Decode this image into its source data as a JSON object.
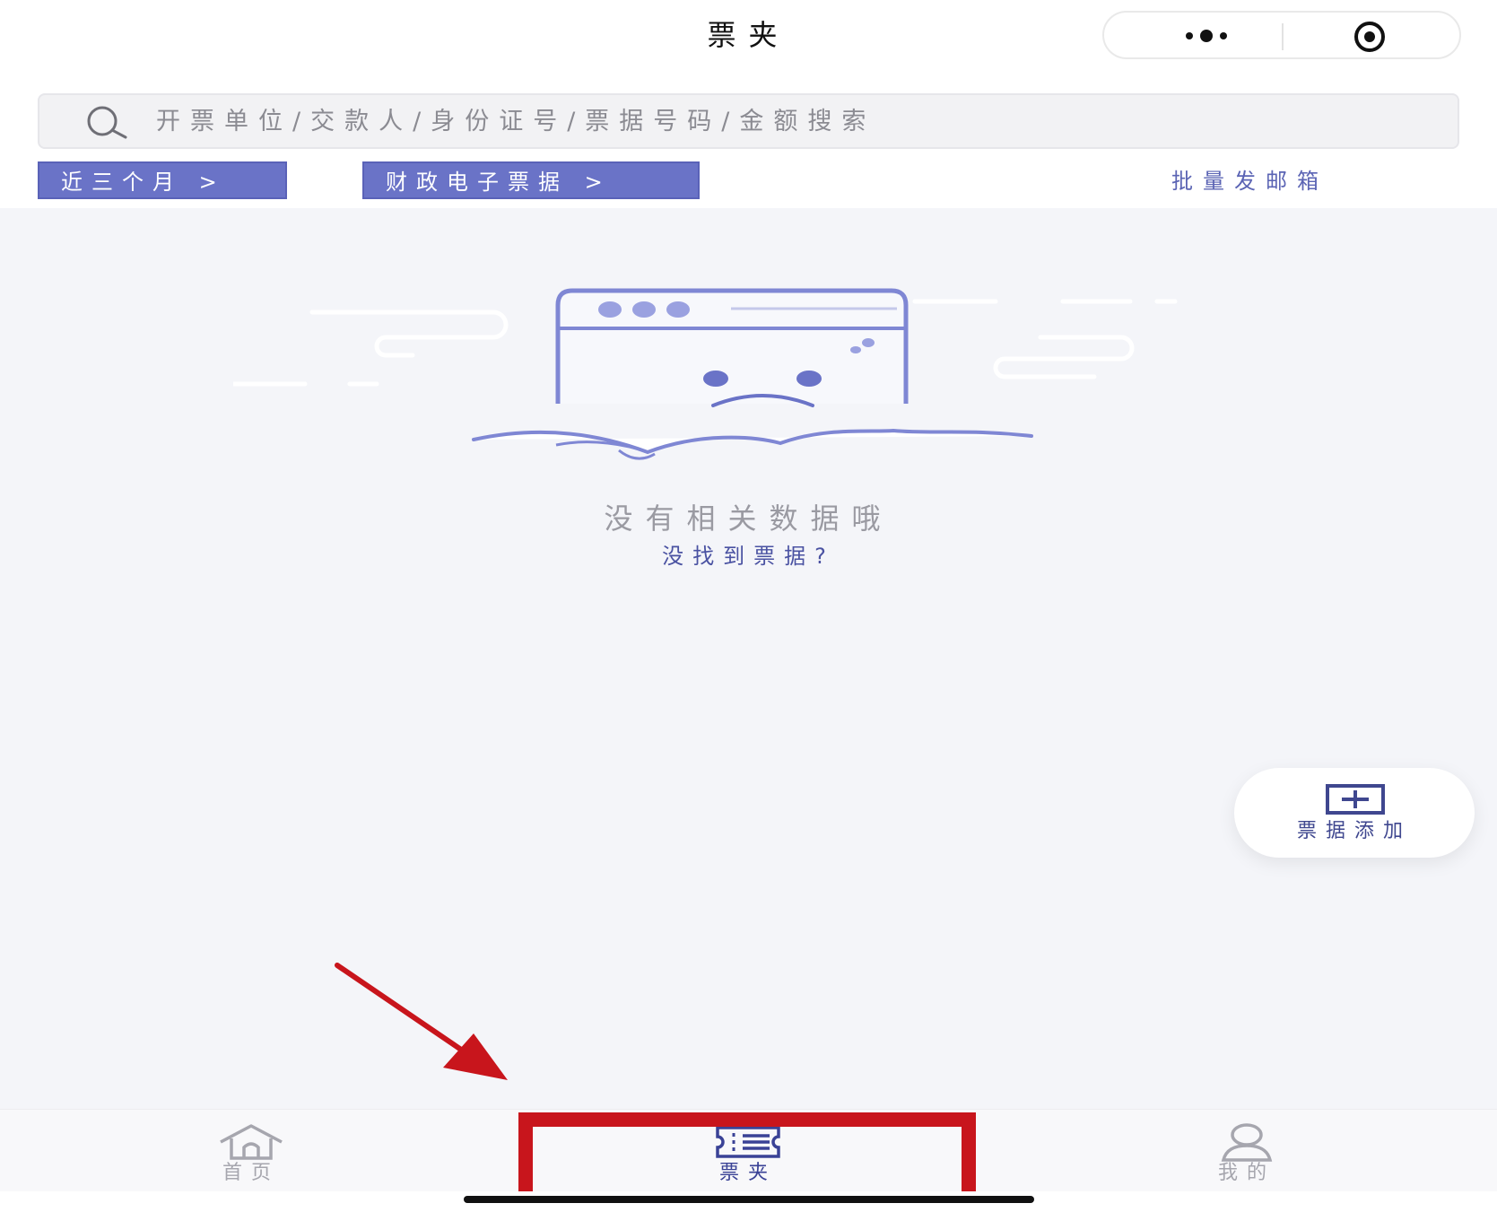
{
  "nav": {
    "title": "票夹"
  },
  "search": {
    "placeholder": "开票单位/交款人/身份证号/票据号码/金额搜索"
  },
  "filters": {
    "period_label": "近三个月 >",
    "type_label": "财政电子票据 >",
    "batch_email_label": "批量发邮箱"
  },
  "empty_state": {
    "title": "没有相关数据哦",
    "link": "没找到票据?"
  },
  "fab": {
    "label": "票据添加",
    "icon": "plus-square-icon"
  },
  "tabbar": {
    "items": [
      {
        "label": "首页",
        "icon": "home-icon",
        "active": false
      },
      {
        "label": "票夹",
        "icon": "ticket-wallet-icon",
        "active": true
      },
      {
        "label": "我的",
        "icon": "user-icon",
        "active": false
      }
    ]
  },
  "colors": {
    "accent": "#6a73c7",
    "accent_dark": "#3a4296",
    "background": "#f4f5f9",
    "annotation_red": "#c8151c"
  }
}
